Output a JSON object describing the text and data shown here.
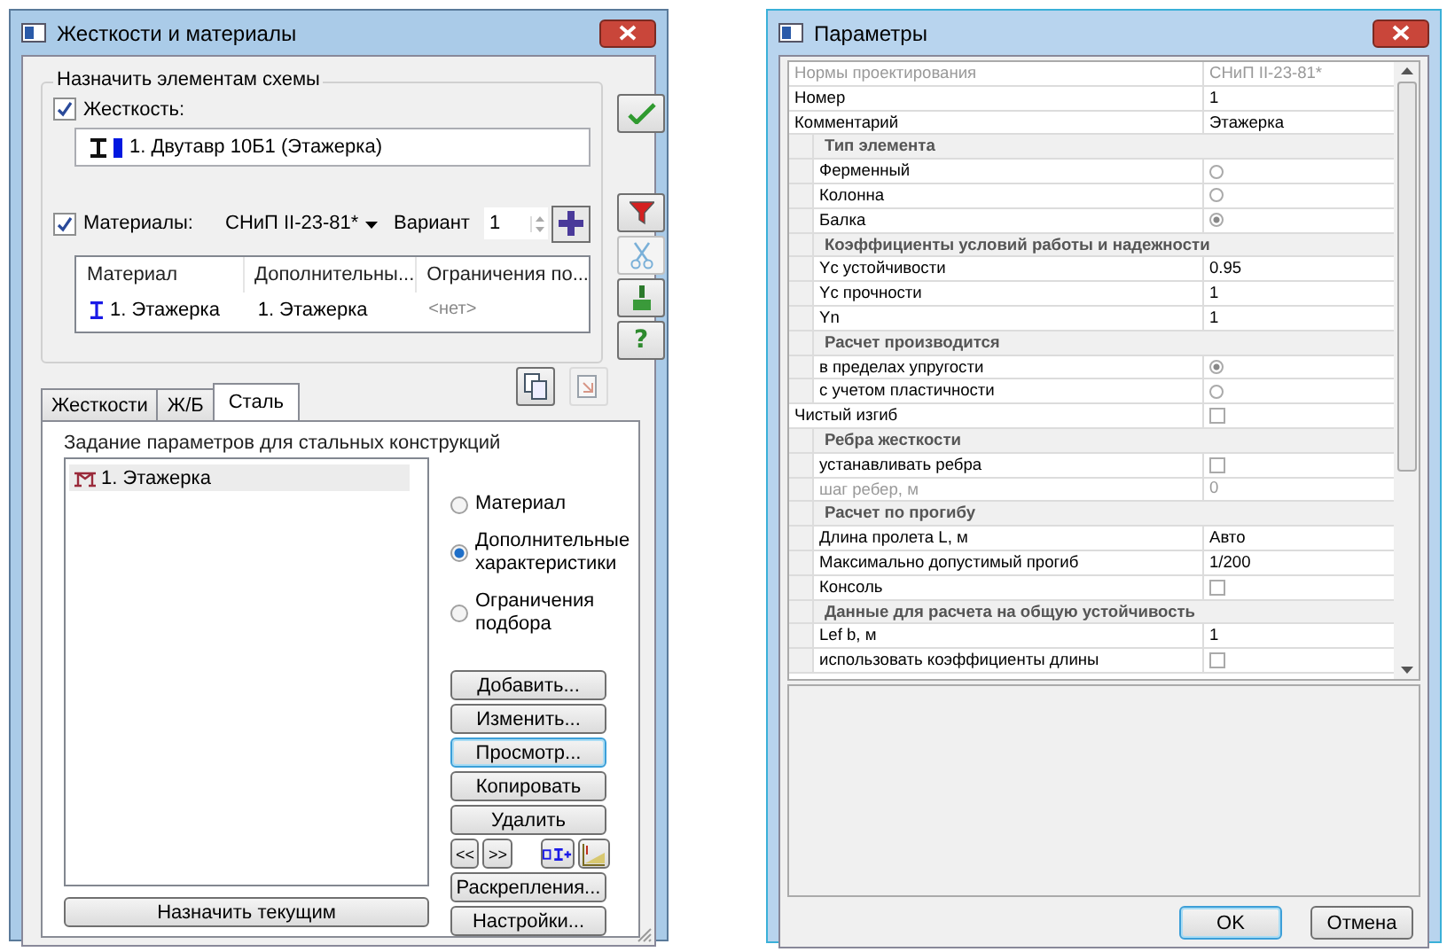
{
  "left_window": {
    "title": "Жесткости и материалы",
    "group_title": "Назначить элементам схемы",
    "stiffness": {
      "label": "Жесткость:",
      "checked": true,
      "value": "1. Двутавр 10Б1 (Этажерка)"
    },
    "materials": {
      "label": "Материалы:",
      "checked": true,
      "norm": "СНиП II-23-81*",
      "variant_label": "Вариант",
      "variant": "1"
    },
    "table": {
      "columns": [
        "Материал",
        "Дополнительны...",
        "Ограничения по..."
      ],
      "rows": [
        {
          "cells": [
            {
              "text": "1. Этажерка",
              "muted": false
            },
            {
              "text": "1. Этажерка",
              "muted": false
            },
            {
              "text": "<нет>",
              "muted": true
            }
          ]
        }
      ]
    },
    "side_tools": [
      {
        "kind": "apply",
        "disabled": false
      },
      {
        "kind": "filter",
        "disabled": false
      },
      {
        "kind": "cut",
        "disabled": true
      },
      {
        "kind": "brush",
        "disabled": false
      },
      {
        "kind": "help",
        "label": "?",
        "disabled": false
      }
    ],
    "clip_tools": [
      {
        "kind": "copy",
        "disabled": false
      },
      {
        "kind": "paste",
        "disabled": true
      }
    ],
    "tabs": [
      {
        "label": "Жесткости",
        "selected": false
      },
      {
        "label": "Ж/Б",
        "selected": false
      },
      {
        "label": "Сталь",
        "selected": true
      }
    ],
    "panel_title": "Задание параметров для стальных конструкций",
    "tree": [
      {
        "label": "1. Этажерка",
        "selected": true
      }
    ],
    "radios": [
      {
        "label": "Материал",
        "selected": false
      },
      {
        "label": "Дополнительные характеристики",
        "selected": true
      },
      {
        "label": "Ограничения подбора",
        "selected": false
      }
    ],
    "actions": [
      {
        "label": "Добавить...",
        "focused": false
      },
      {
        "label": "Изменить...",
        "focused": false
      },
      {
        "label": "Просмотр...",
        "focused": true
      },
      {
        "label": "Копировать",
        "focused": false
      },
      {
        "label": "Удалить",
        "focused": false
      }
    ],
    "nav_buttons": [
      "<<",
      ">>"
    ],
    "nav_tools": [
      {
        "kind": "section"
      },
      {
        "kind": "chart"
      }
    ],
    "more_actions": [
      {
        "label": "Раскрепления...",
        "focused": false
      },
      {
        "label": "Настройки...",
        "focused": false
      }
    ],
    "assign_button": "Назначить текущим"
  },
  "right_window": {
    "title": "Параметры",
    "rows": [
      {
        "kind": "param",
        "label": "Нормы проектирования",
        "value": "СНиП II-23-81*",
        "disabled": true
      },
      {
        "kind": "param",
        "label": "Номер",
        "value": "1",
        "disabled": false
      },
      {
        "kind": "param",
        "label": "Комментарий",
        "value": "Этажерка",
        "disabled": false
      },
      {
        "kind": "section",
        "label": "Тип элемента",
        "children": [
          {
            "kind": "radio",
            "label": "Ферменный",
            "selected": false
          },
          {
            "kind": "radio",
            "label": "Колонна",
            "selected": false
          },
          {
            "kind": "radio",
            "label": "Балка",
            "selected": true
          }
        ]
      },
      {
        "kind": "section",
        "label": "Коэффициенты условий работы и надежности",
        "children": [
          {
            "kind": "param",
            "label": "Yc устойчивости",
            "value": "0.95",
            "disabled": false
          },
          {
            "kind": "param",
            "label": "Yc прочности",
            "value": "1",
            "disabled": false
          },
          {
            "kind": "param",
            "label": "Yn",
            "value": "1",
            "disabled": false
          }
        ]
      },
      {
        "kind": "section",
        "label": "Расчет производится",
        "children": [
          {
            "kind": "radio",
            "label": "в пределах упругости",
            "selected": true
          },
          {
            "kind": "radio",
            "label": "с учетом пластичности",
            "selected": false
          }
        ]
      },
      {
        "kind": "check",
        "label": "Чистый изгиб",
        "checked": false
      },
      {
        "kind": "section",
        "label": "Ребра жесткости",
        "children": [
          {
            "kind": "check",
            "label": "устанавливать ребра",
            "checked": false
          },
          {
            "kind": "param",
            "label": "шаг ребер, м",
            "value": "0",
            "disabled": true
          }
        ]
      },
      {
        "kind": "section",
        "label": "Расчет по прогибу",
        "children": [
          {
            "kind": "param",
            "label": "Длина пролета L, м",
            "value": "Авто",
            "disabled": false
          },
          {
            "kind": "param",
            "label": "Максимально допустимый прогиб",
            "value": "1/200",
            "disabled": false
          },
          {
            "kind": "check",
            "label": "Консоль",
            "checked": false
          }
        ]
      },
      {
        "kind": "section",
        "label": "Данные для расчета на общую устойчивость",
        "children": [
          {
            "kind": "param",
            "label": "Lef b, м",
            "value": "1",
            "disabled": false
          },
          {
            "kind": "check",
            "label": "использовать коэффициенты длины",
            "checked": false
          }
        ]
      }
    ],
    "buttons": [
      {
        "label": "OK",
        "focused": true
      },
      {
        "label": "Отмена",
        "focused": false
      }
    ]
  }
}
